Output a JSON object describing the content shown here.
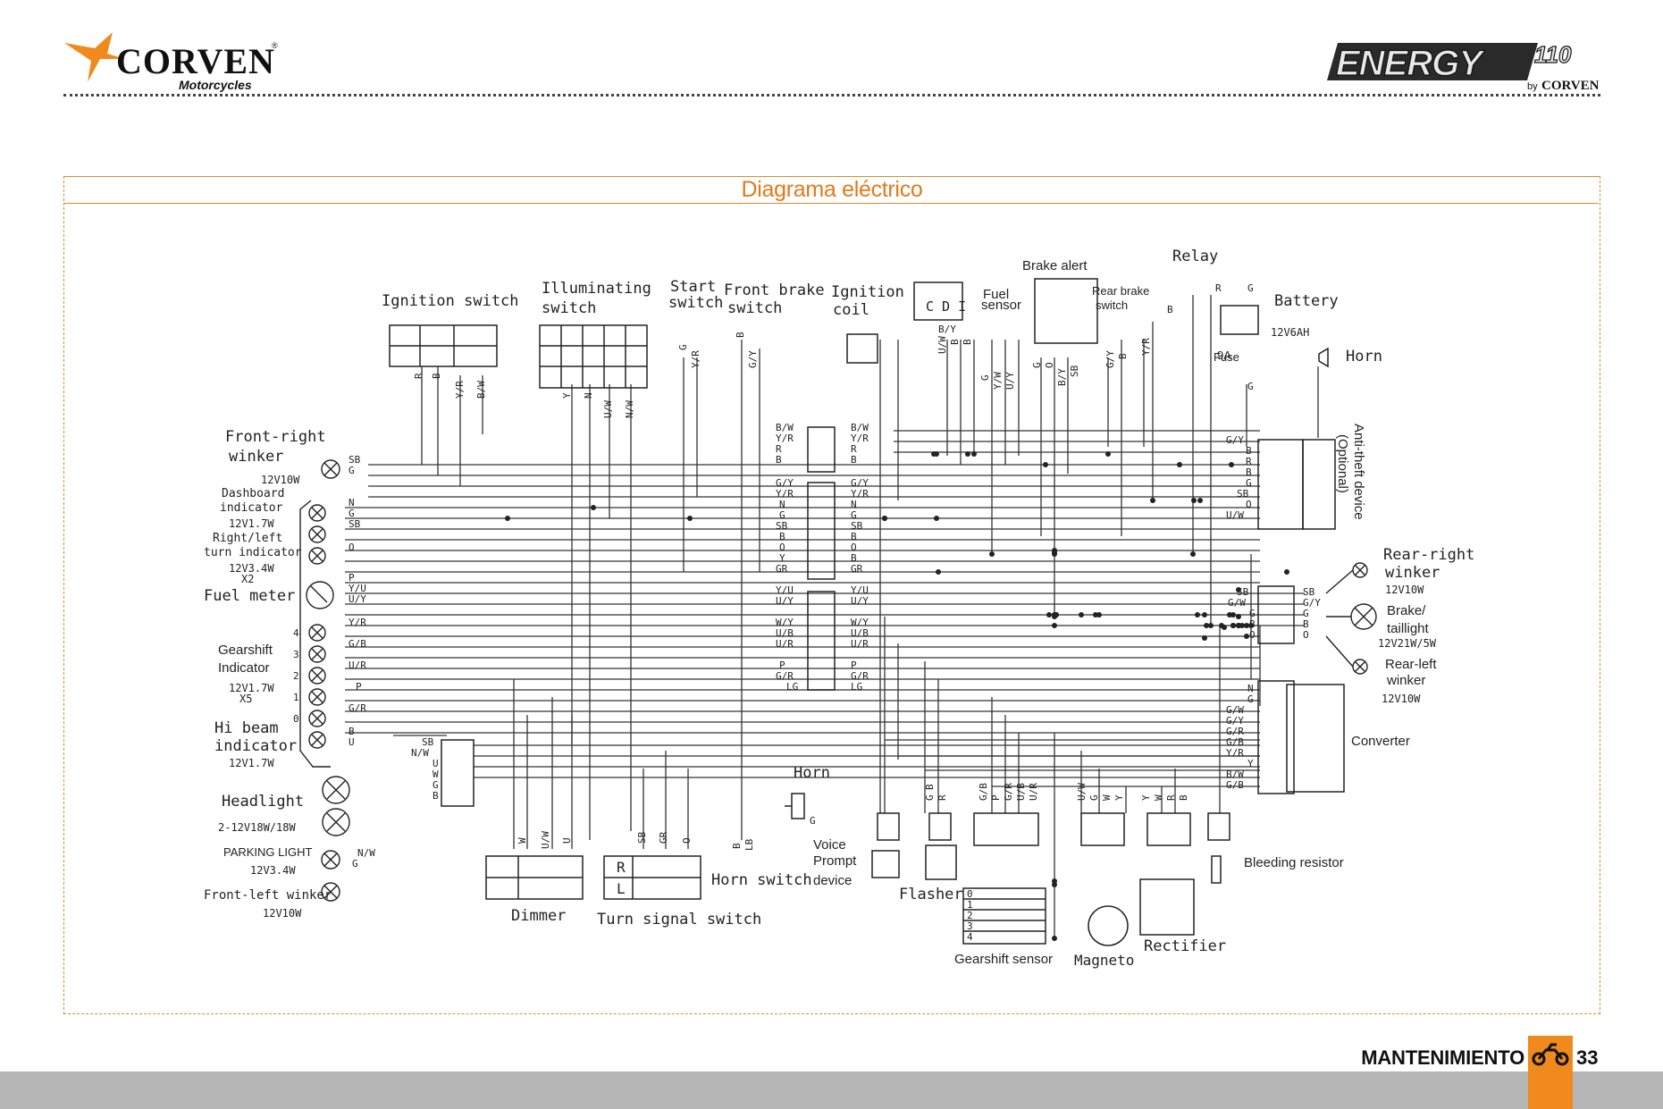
{
  "header": {
    "brand": "CORVEN",
    "brand_tagline": "Motorcycles",
    "model_logo": "ENERGY",
    "model_number": "110",
    "model_by": "by",
    "model_by_brand": "CORVEN"
  },
  "frame": {
    "title": "Diagrama eléctrico"
  },
  "diagram": {
    "components": {
      "ignition_switch": "Ignition switch",
      "illuminating_switch_1": "Illuminating",
      "illuminating_switch_2": "switch",
      "start_switch_1": "Start",
      "start_switch_2": "switch",
      "front_brake_switch_1": "Front brake",
      "front_brake_switch_2": "switch",
      "ignition_coil_1": "Ignition",
      "ignition_coil_2": "coil",
      "cdi": "C D I",
      "fuel_sensor_1": "Fuel",
      "fuel_sensor_2": "sensor",
      "brake_alert": "Brake alert",
      "rear_brake_switch_1": "Rear brake",
      "rear_brake_switch_2": "switch",
      "relay": "Relay",
      "battery": "Battery",
      "battery_spec": "12V6AH",
      "fuse_rating": "9A",
      "fuse": "Fuse",
      "horn_top": "Horn",
      "anti_theft_1": "Anti-theft device",
      "anti_theft_2": "(Optional)",
      "front_right_winker_1": "Front-right",
      "front_right_winker_2": "winker",
      "front_right_winker_spec": "12V10W",
      "dashboard_indicator_1": "Dashboard",
      "dashboard_indicator_2": "indicator",
      "dashboard_indicator_spec": "12V1.7W",
      "turn_indicator_1": "Right/left",
      "turn_indicator_2": "turn indicator",
      "turn_indicator_spec": "12V3.4W",
      "turn_indicator_qty": "X2",
      "fuel_meter": "Fuel meter",
      "gearshift_indicator_1": "Gearshift",
      "gearshift_indicator_2": "Indicator",
      "gearshift_indicator_spec": "12V1.7W",
      "gearshift_indicator_qty": "X5",
      "hi_beam_1": "Hi beam",
      "hi_beam_2": "indicator",
      "hi_beam_spec": "12V1.7W",
      "headlight": "Headlight",
      "headlight_spec": "2-12V18W/18W",
      "parking_light": "PARKING LIGHT",
      "parking_light_spec": "12V3.4W",
      "front_left_winker": "Front-left winker",
      "front_left_winker_spec": "12V10W",
      "dimmer": "Dimmer",
      "turn_signal_switch": "Turn signal switch",
      "turn_signal_r": "R",
      "turn_signal_l": "L",
      "horn_switch": "Horn switch",
      "horn_mid": "Horn",
      "voice_prompt_1": "Voice",
      "voice_prompt_2": "Prompt",
      "voice_prompt_3": "device",
      "flasher": "Flasher",
      "gearshift_sensor": "Gearshift sensor",
      "magneto": "Magneto",
      "rectifier": "Rectifier",
      "bleeding_resistor": "Bleeding resistor",
      "converter": "Converter",
      "rear_right_winker_1": "Rear-right",
      "rear_right_winker_2": "winker",
      "rear_right_winker_spec": "12V10W",
      "brake_taillight_1": "Brake/",
      "brake_taillight_2": "taillight",
      "brake_taillight_spec": "12V21W/5W",
      "rear_left_winker_1": "Rear-left",
      "rear_left_winker_2": "winker",
      "rear_left_winker_spec": "12V10W"
    },
    "connector_left_1": [
      "B/W",
      "Y/R",
      "R",
      "B"
    ],
    "connector_right_1": [
      "B/W",
      "Y/R",
      "R",
      "B"
    ],
    "connector_left_2": [
      "G/Y",
      "Y/R",
      "N",
      "G",
      "SB",
      "B",
      "O",
      "Y",
      "GR"
    ],
    "connector_right_2": [
      "G/Y",
      "Y/R",
      "N",
      "G",
      "SB",
      "B",
      "O",
      "B",
      "GR"
    ],
    "connector_left_3": [
      "Y/U",
      "U/Y",
      "",
      "W/Y",
      "U/B",
      "U/R",
      "",
      "P",
      "G/R",
      "LG"
    ],
    "connector_right_3": [
      "Y/U",
      "U/Y",
      "",
      "W/Y",
      "U/B",
      "U/R",
      "",
      "P",
      "G/R",
      "LG"
    ],
    "dash_wires": [
      "SB",
      "G",
      "N",
      "G",
      "SB",
      "O",
      "P",
      "Y/U",
      "U/Y",
      "Y/R",
      "G/B",
      "U/R",
      "P",
      "G/R",
      "B",
      "U"
    ],
    "gear_numbers": [
      "4",
      "3",
      "2",
      "1",
      "0"
    ],
    "top_wires_ignition": [
      "R",
      "B",
      "Y/R",
      "B/W"
    ],
    "top_wires_illuminating": [
      "Y",
      "N",
      "U/W",
      "N/W"
    ],
    "top_wires_start": [
      "G",
      "Y/R"
    ],
    "top_wires_brake": [
      "B",
      "G/Y"
    ],
    "coil_wire": "B/Y",
    "cdi_wires": [
      "U/W",
      "B",
      "B"
    ],
    "fuel_wires": [
      "G",
      "Y/W",
      "U/Y"
    ],
    "brake_alert_wires": [
      "G",
      "O",
      "B/Y",
      "SB"
    ],
    "rear_brake_wires": [
      "G/Y",
      "B"
    ],
    "relay_wires": [
      "R",
      "G",
      "Y/R",
      "B",
      "G"
    ],
    "anti_theft_wires": [
      "G/Y",
      "B",
      "R",
      "B",
      "G",
      "SB",
      "O",
      "U/W"
    ],
    "rear_connector_wires": [
      "SB",
      "G/W",
      "G",
      "B",
      "O"
    ],
    "rear_right_wires": [
      "SB",
      "G/Y",
      "G",
      "B",
      "O"
    ],
    "converter_wires": [
      "N",
      "G",
      "G/W",
      "G/Y",
      "G/R",
      "G/B",
      "Y/R",
      "Y",
      "B/W",
      "G/B"
    ],
    "headlight_wires": [
      "SB",
      "N/W",
      "U",
      "W",
      "G",
      "B",
      "G"
    ],
    "parking_wires": [
      "N/W",
      "G"
    ],
    "dimmer_wires": [
      "W",
      "U/W",
      "U"
    ],
    "turn_switch_wires": [
      "SB",
      "GR",
      "O"
    ],
    "horn_switch_wires": [
      "B",
      "LB"
    ],
    "horn_wire": "G",
    "flasher_wires": [
      "G",
      "B",
      "R"
    ],
    "gear_sensor_wires": [
      "G/B",
      "P",
      "G/R",
      "U/B",
      "U/R"
    ],
    "gear_sensor_rows": [
      "0",
      "1",
      "2",
      "3",
      "4"
    ],
    "magneto_wires": [
      "U/W",
      "G",
      "W",
      "Y"
    ],
    "rectifier_wires": [
      "Y",
      "W",
      "R",
      "B"
    ]
  },
  "footer": {
    "section": "MANTENIMIENTO",
    "page": "33",
    "icon": "motorcycle-icon"
  }
}
